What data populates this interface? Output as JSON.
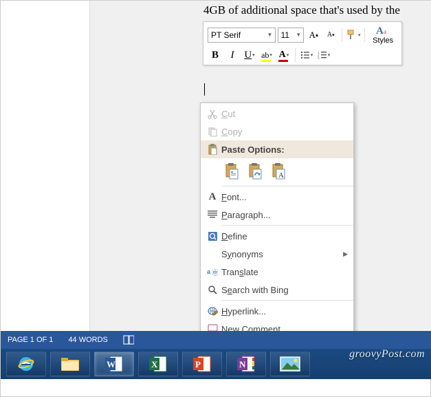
{
  "document": {
    "visible_text": "4GB of additional space that's used by the"
  },
  "mini_toolbar": {
    "font_name": "PT Serif",
    "font_size": "11",
    "styles_label": "Styles"
  },
  "context_menu": {
    "cut": "Cut",
    "copy": "Copy",
    "paste_options": "Paste Options:",
    "font": "Font...",
    "paragraph": "Paragraph...",
    "define": "Define",
    "synonyms": "Synonyms",
    "translate": "Translate",
    "search_bing": "Search with Bing",
    "hyperlink": "Hyperlink...",
    "new_comment": "New Comment"
  },
  "statusbar": {
    "page": "PAGE 1 OF 1",
    "words": "44 WORDS"
  },
  "watermark": "groovyPost.com"
}
